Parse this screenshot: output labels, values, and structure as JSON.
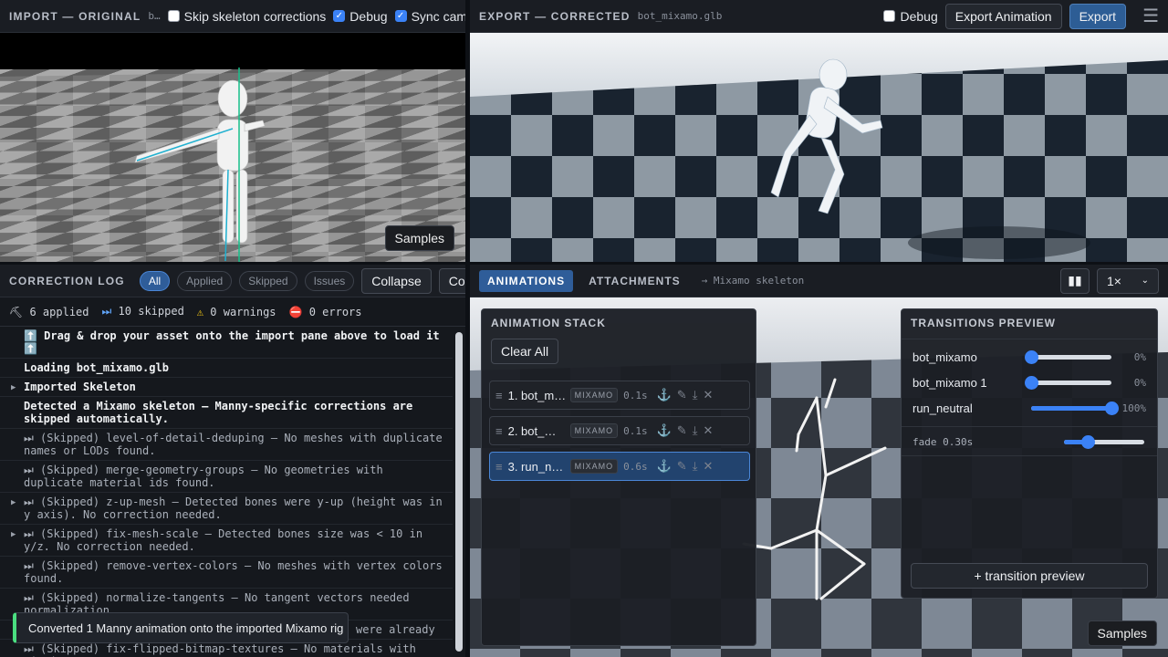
{
  "import": {
    "title": "IMPORT — ORIGINAL",
    "filename": "b…",
    "skip_label": "Skip skeleton corrections",
    "debug_label": "Debug",
    "sync_label": "Sync cameras",
    "samples": "Samples"
  },
  "export": {
    "title": "EXPORT — CORRECTED",
    "filename": "bot_mixamo.glb",
    "debug_label": "Debug",
    "export_animation": "Export Animation",
    "export": "Export",
    "samples": "Samples"
  },
  "log": {
    "title": "CORRECTION LOG",
    "filters": [
      "All",
      "Applied",
      "Skipped",
      "Issues"
    ],
    "collapse": "Collapse",
    "copy": "Copy",
    "stats": {
      "applied": "6 applied",
      "skipped": "10 skipped",
      "warnings": "0 warnings",
      "errors": "0 errors"
    },
    "entries": [
      {
        "text": "⬆️ Drag & drop your asset onto the import pane above to load it ⬆️",
        "bold": true
      },
      {
        "text": "Loading bot_mixamo.glb",
        "bold": true
      },
      {
        "text": "Imported Skeleton",
        "bold": true,
        "twisty": "▶"
      },
      {
        "text": "Detected a Mixamo skeleton — Manny-specific corrections are skipped automatically.",
        "bold": true
      },
      {
        "text": "⏭ (Skipped) level-of-detail-deduping — No meshes with duplicate names or LODs found."
      },
      {
        "text": "⏭ (Skipped) merge-geometry-groups — No geometries with duplicate material ids found."
      },
      {
        "text": "⏭ (Skipped) z-up-mesh — Detected bones were y-up (height was in y axis). No correction needed.",
        "twisty": "▶"
      },
      {
        "text": "⏭ (Skipped) fix-mesh-scale — Detected bones size was < 10 in y/z. No correction needed.",
        "twisty": "▶"
      },
      {
        "text": "⏭ (Skipped) remove-vertex-colors — No meshes with vertex colors found."
      },
      {
        "text": "⏭ (Skipped) normalize-tangents — No tangent vectors needed normalization."
      },
      {
        "text": "were already"
      },
      {
        "text": "⏭ (Skipped) fix-flipped-bitmap-textures — No materials with missing"
      }
    ],
    "toast": "Converted 1 Manny animation onto the imported Mixamo rig"
  },
  "anim": {
    "tabs": [
      "ANIMATIONS",
      "ATTACHMENTS"
    ],
    "skeleton": "→ Mixamo skeleton",
    "speed": "1×",
    "stack_title": "ANIMATION STACK",
    "clear_all": "Clear All",
    "rows": [
      {
        "name": "1. bot_m…",
        "tag": "MIXAMO",
        "dur": "0.1s"
      },
      {
        "name": "2. bot_…",
        "tag": "MIXAMO",
        "dur": "0.1s"
      },
      {
        "name": "3. run_n…",
        "tag": "MIXAMO",
        "dur": "0.6s"
      }
    ],
    "transitions_title": "TRANSITIONS PREVIEW",
    "transitions": [
      {
        "name": "bot_mixamo",
        "value": 0,
        "label": "0%"
      },
      {
        "name": "bot_mixamo 1",
        "value": 0,
        "label": "0%"
      },
      {
        "name": "run_neutral",
        "value": 1,
        "label": "100%"
      }
    ],
    "fade_label": "fade 0.30s",
    "fade_value": 0.3,
    "add_transition": "+ transition preview",
    "samples": "Samples"
  }
}
